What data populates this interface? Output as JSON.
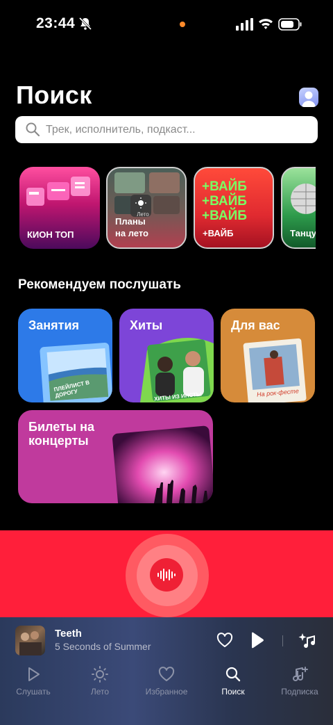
{
  "status_bar": {
    "time": "23:44"
  },
  "header": {
    "title": "Поиск"
  },
  "search": {
    "placeholder": "Трек, исполнитель, подкаст..."
  },
  "carousel": [
    {
      "label": "КИОН ТОП"
    },
    {
      "label": "Планы\nна лето",
      "badge": "Лето"
    },
    {
      "label": "+ВАЙБ",
      "art_text": "+ВАЙБ\n+ВАЙБ\n+ВАЙБ"
    },
    {
      "label": "Танцу"
    }
  ],
  "recommend": {
    "title": "Рекомендуем послушать",
    "cards": [
      {
        "label": "Занятия",
        "art_caption": "ПЛЕЙЛИСТ В ДОРОГУ",
        "color": "#2d7ae8"
      },
      {
        "label": "Хиты",
        "art_caption": "ХИТЫ ИЗ ИНСТЫ",
        "color": "#7d45d8"
      },
      {
        "label": "Для вас",
        "art_caption": "На рок-фесте",
        "color": "#d68b3a"
      },
      {
        "label": "Билеты на\nконцерты",
        "color": "#c03a9d"
      }
    ]
  },
  "voice_search": {
    "icon": "waveform-icon",
    "color": "#ff1f3a"
  },
  "player": {
    "track": "Teeth",
    "artist": "5 Seconds of Summer"
  },
  "nav": {
    "items": [
      {
        "label": "Слушать",
        "icon": "play-icon"
      },
      {
        "label": "Лето",
        "icon": "sun-icon"
      },
      {
        "label": "Избранное",
        "icon": "heart-icon"
      },
      {
        "label": "Поиск",
        "icon": "search-icon",
        "active": true
      },
      {
        "label": "Подписка",
        "icon": "music-plus-icon"
      }
    ]
  }
}
